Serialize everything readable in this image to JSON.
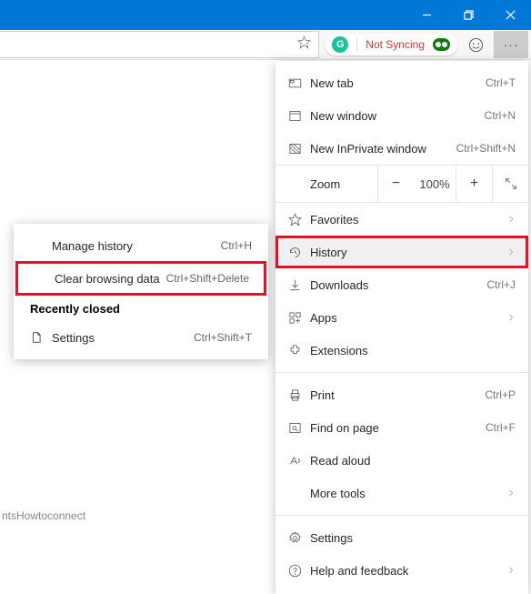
{
  "titlebar": {
    "minimize": "minimize",
    "restore": "restore",
    "close": "close"
  },
  "toolbar": {
    "sync_status": "Not Syncing",
    "more": "···"
  },
  "menu": {
    "new_tab": {
      "label": "New tab",
      "shortcut": "Ctrl+T"
    },
    "new_window": {
      "label": "New window",
      "shortcut": "Ctrl+N"
    },
    "new_inprivate": {
      "label": "New InPrivate window",
      "shortcut": "Ctrl+Shift+N"
    },
    "zoom": {
      "label": "Zoom",
      "value": "100%"
    },
    "favorites": {
      "label": "Favorites"
    },
    "history": {
      "label": "History"
    },
    "downloads": {
      "label": "Downloads",
      "shortcut": "Ctrl+J"
    },
    "apps": {
      "label": "Apps"
    },
    "extensions": {
      "label": "Extensions"
    },
    "print": {
      "label": "Print",
      "shortcut": "Ctrl+P"
    },
    "find": {
      "label": "Find on page",
      "shortcut": "Ctrl+F"
    },
    "read_aloud": {
      "label": "Read aloud"
    },
    "more_tools": {
      "label": "More tools"
    },
    "settings": {
      "label": "Settings"
    },
    "help": {
      "label": "Help and feedback"
    }
  },
  "submenu": {
    "manage": {
      "label": "Manage history",
      "shortcut": "Ctrl+H"
    },
    "clear": {
      "label": "Clear browsing data",
      "shortcut": "Ctrl+Shift+Delete"
    },
    "recent_head": "Recently closed",
    "recent1": {
      "label": "Settings",
      "shortcut": "Ctrl+Shift+T"
    }
  },
  "footer": {
    "watermark": "ntsHowtoconnect"
  }
}
